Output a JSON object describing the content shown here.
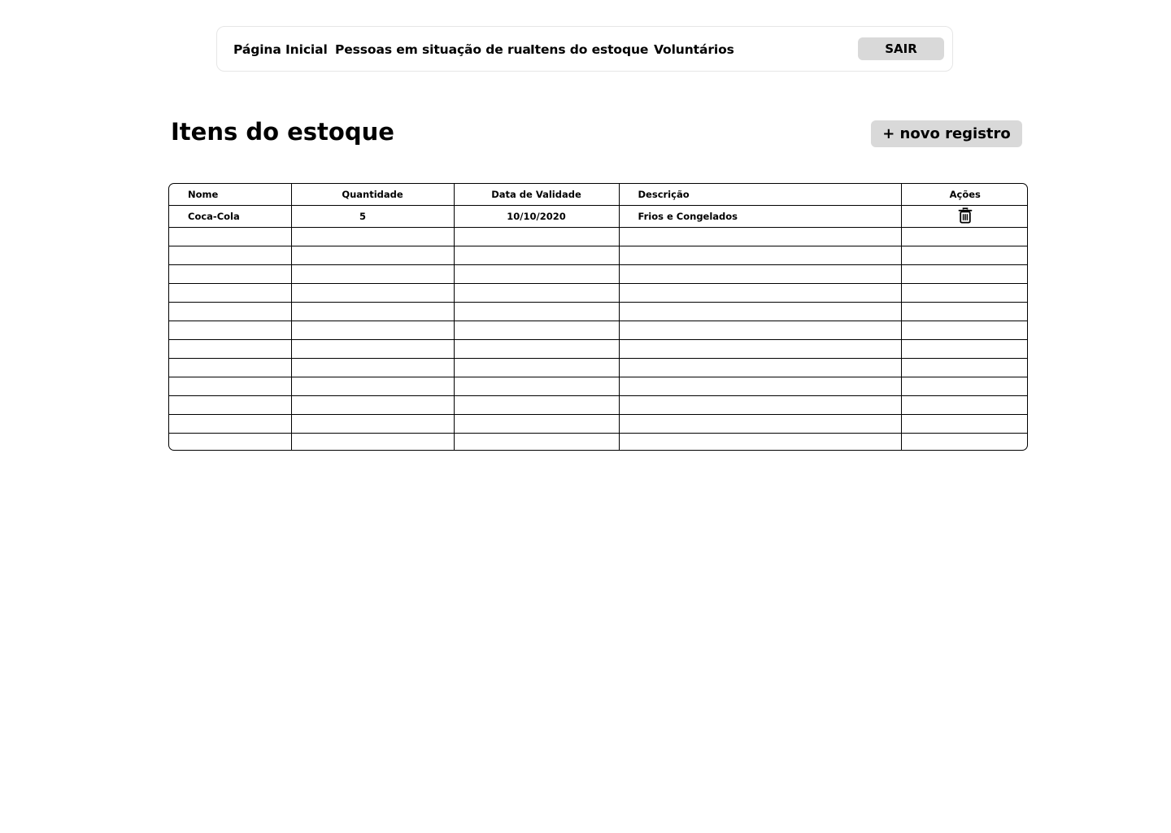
{
  "nav": {
    "links": [
      {
        "label": "Página Inicial"
      },
      {
        "label": "Pessoas em situação de rua"
      },
      {
        "label": "Itens do estoque"
      },
      {
        "label": "Voluntários"
      }
    ],
    "logout_label": "SAIR"
  },
  "page": {
    "title": "Itens do estoque",
    "new_record_label": "+ novo registro"
  },
  "table": {
    "columns": [
      "Nome",
      "Quantidade",
      "Data de Validade",
      "Descrição",
      "Ações"
    ],
    "rows": [
      {
        "nome": "Coca-Cola",
        "quantidade": "5",
        "validade": "10/10/2020",
        "descricao": "Frios e Congelados",
        "action_icon": "trash-icon"
      }
    ],
    "empty_row_count": 12
  },
  "colors": {
    "button_bg": "#d9d9d9",
    "border": "#000000",
    "nav_border": "#e6e6e6"
  }
}
